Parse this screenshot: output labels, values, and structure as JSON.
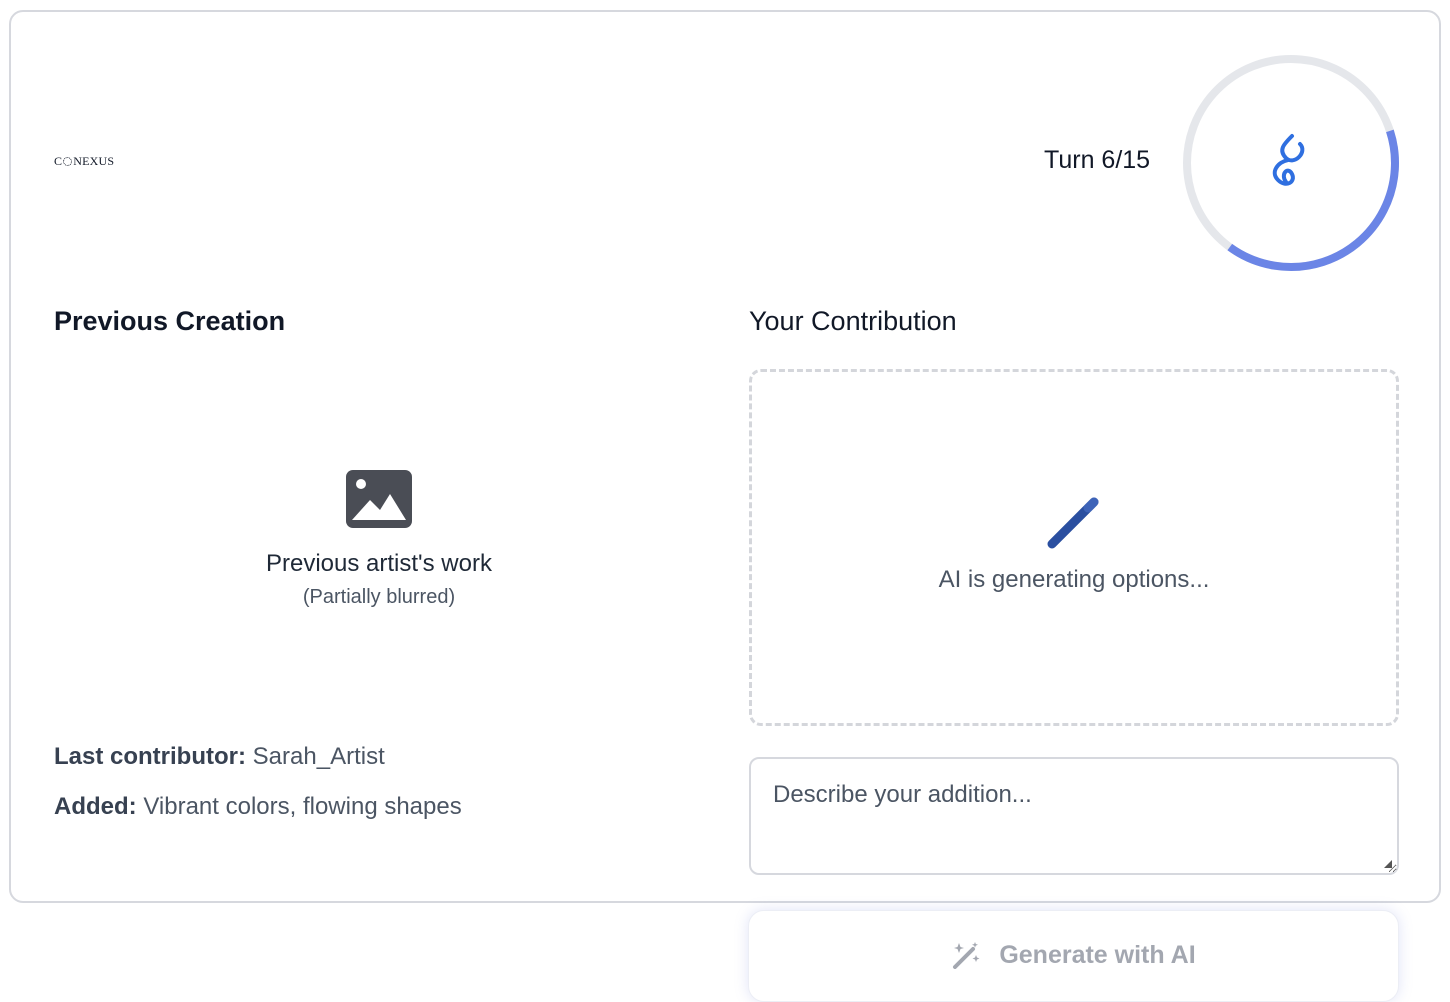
{
  "header": {
    "logo_prefix": "C",
    "logo_suffix": "NEXUS",
    "turn_label": "Turn 6/15",
    "timer_progress": 0.4
  },
  "previous": {
    "title": "Previous Creation",
    "caption": "Previous artist's work",
    "subcaption": "(Partially blurred)",
    "last_contributor_label": "Last contributor:",
    "last_contributor_value": "Sarah_Artist",
    "added_label": "Added:",
    "added_value": "Vibrant colors, flowing shapes"
  },
  "contribution": {
    "title": "Your Contribution",
    "status_text": "AI is generating options...",
    "describe_placeholder": "Describe your addition...",
    "generate_label": "Generate with AI"
  },
  "colors": {
    "accent": "#2f6fe0",
    "timer_arc": "#6b85e6",
    "timer_track": "#e5e7eb",
    "wand": "#2a4fa0"
  },
  "icons": {
    "timer_center": "hourglass-flow-icon",
    "previous_image": "image-icon",
    "contribution": "magic-wand-icon",
    "generate": "sparkle-wand-icon"
  }
}
